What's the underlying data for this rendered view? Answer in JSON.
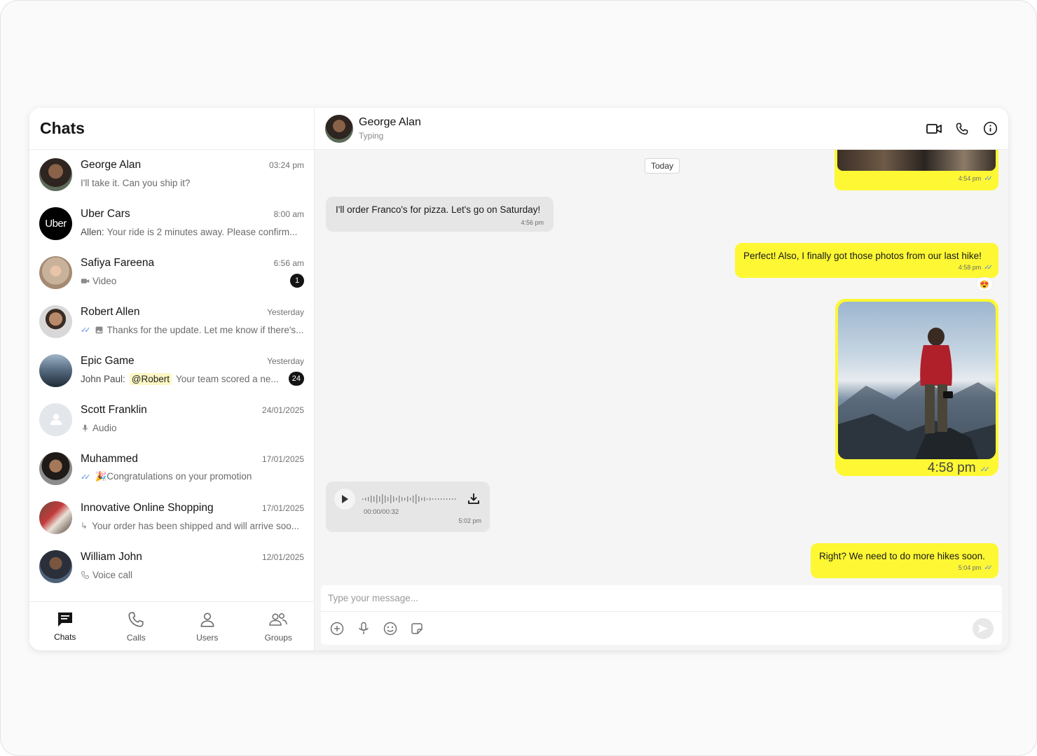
{
  "sidebar": {
    "title": "Chats",
    "chats": [
      {
        "name": "George Alan",
        "time": "03:24 pm",
        "preview": "I'll take it. Can you ship it?"
      },
      {
        "name": "Uber Cars",
        "time": "8:00 am",
        "sender": "Allen:",
        "preview": "Your ride is 2 minutes away. Please confirm...",
        "avatar_text": "Uber"
      },
      {
        "name": "Safiya Fareena",
        "time": "6:56 am",
        "preview": "Video",
        "unread": "1"
      },
      {
        "name": "Robert Allen",
        "time": "Yesterday",
        "preview": "Thanks for the update. Let me know if there's..."
      },
      {
        "name": "Epic Game",
        "time": "Yesterday",
        "sender": "John Paul:",
        "mention": "@Robert",
        "preview": "Your team scored a ne...",
        "unread": "24"
      },
      {
        "name": "Scott Franklin",
        "time": "24/01/2025",
        "preview": "Audio"
      },
      {
        "name": "Muhammed",
        "time": "17/01/2025",
        "preview": "🎉Congratulations on your promotion"
      },
      {
        "name": "Innovative Online Shopping",
        "time": "17/01/2025",
        "preview": "Your order has been shipped and will arrive soo..."
      },
      {
        "name": "William John",
        "time": "12/01/2025",
        "preview": "Voice call"
      }
    ],
    "tabs": [
      {
        "label": "Chats",
        "icon": "chat-icon"
      },
      {
        "label": "Calls",
        "icon": "phone-icon"
      },
      {
        "label": "Users",
        "icon": "user-icon"
      },
      {
        "label": "Groups",
        "icon": "groups-icon"
      }
    ]
  },
  "conversation": {
    "name": "George Alan",
    "status": "Typing",
    "date_separator": "Today",
    "messages": [
      {
        "dir": "out",
        "type": "image-partial",
        "time": "4:54 pm"
      },
      {
        "dir": "in",
        "type": "text",
        "text": "I'll order Franco's for pizza. Let's go on Saturday!",
        "time": "4:56 pm"
      },
      {
        "dir": "out",
        "type": "text",
        "text": "Perfect! Also, I finally got those photos from our last hike!",
        "time": "4:58 pm",
        "reaction": "😍"
      },
      {
        "dir": "out",
        "type": "image",
        "time": "4:58 pm"
      },
      {
        "dir": "in",
        "type": "audio",
        "duration": "00:00/00:32",
        "time": "5:02 pm"
      },
      {
        "dir": "out",
        "type": "text",
        "text": "Right? We need to do more hikes soon.",
        "time": "5:04 pm"
      }
    ]
  },
  "composer": {
    "placeholder": "Type your message..."
  },
  "colors": {
    "accent": "#fdf833",
    "incoming_bubble": "#e6e6e6",
    "read_tick": "#5a8fe0"
  }
}
